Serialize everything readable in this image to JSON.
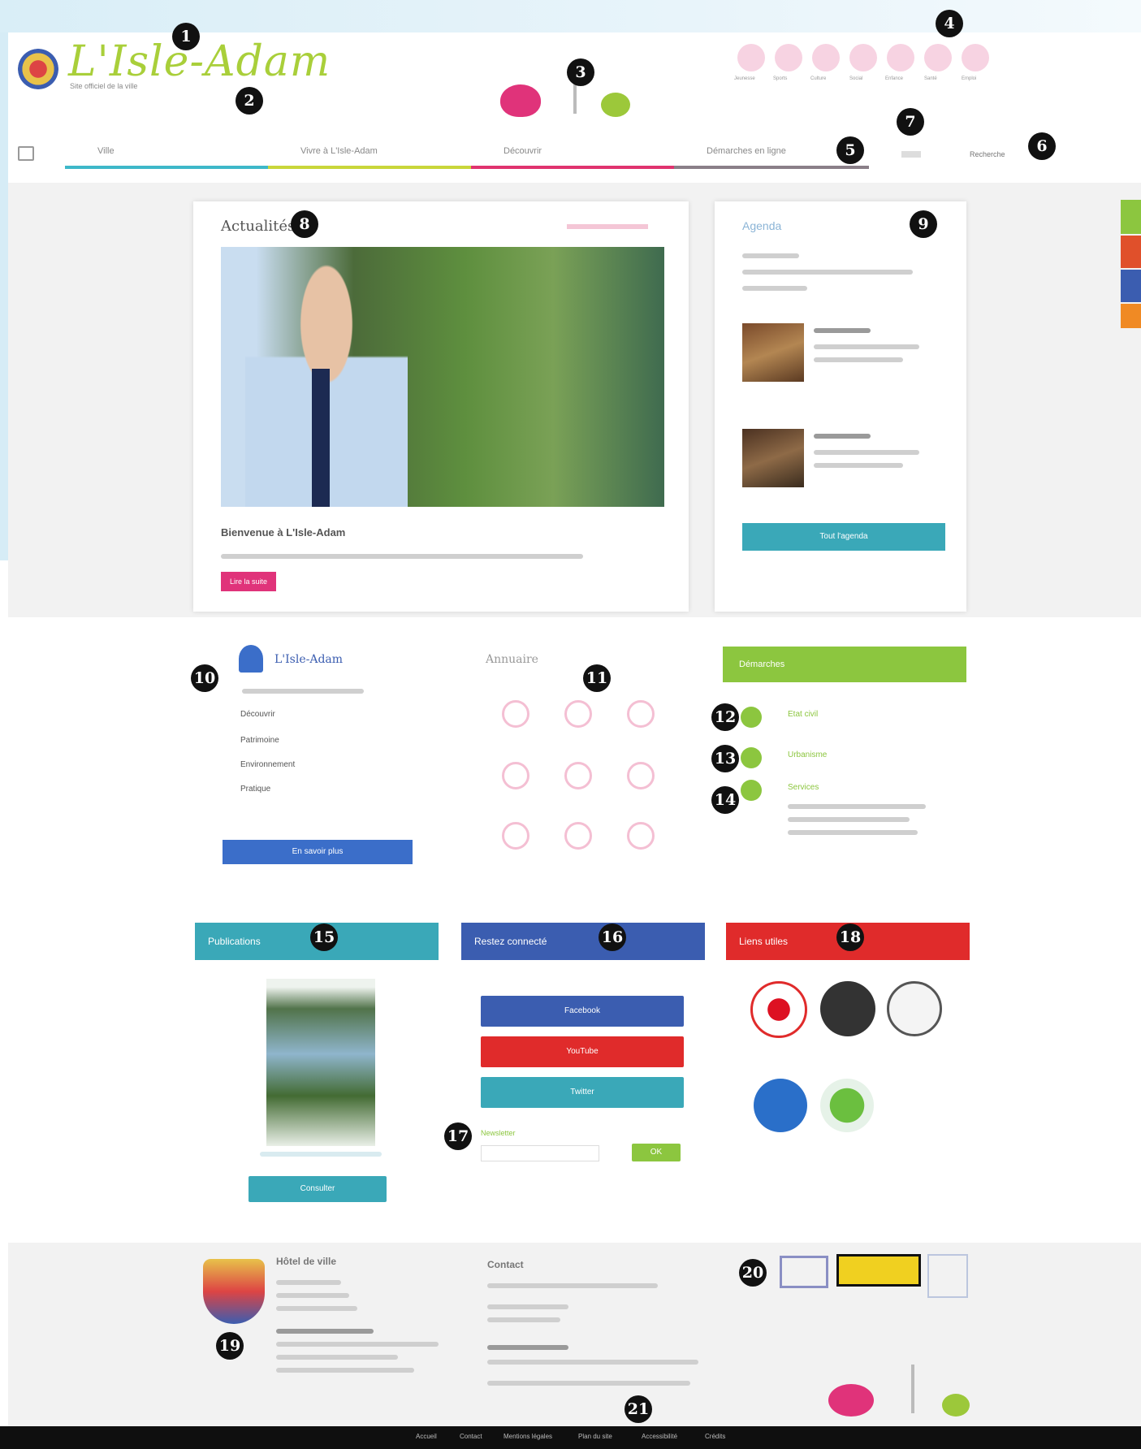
{
  "header": {
    "logo_text": "L'Isle-Adam",
    "tagline": "Site officiel de la ville",
    "quick_links": [
      "Jeunesse",
      "Sports",
      "Culture",
      "Social",
      "Enfance",
      "Santé",
      "Emploi"
    ]
  },
  "nav": {
    "items": [
      "Ville",
      "Vivre à L'Isle-Adam",
      "Découvrir",
      "Démarches en ligne"
    ],
    "search_placeholder": "Recherche",
    "accent_colors": [
      "#3eb8c9",
      "#c9d63a",
      "#e0336f",
      "#8a7f88"
    ]
  },
  "sections": {
    "actu": {
      "title": "Actualités",
      "caption": "Bienvenue à L'Isle-Adam",
      "more": "Lire la suite"
    },
    "agenda": {
      "title": "Agenda",
      "all_button": "Tout l'agenda"
    },
    "lisle_adam": {
      "title": "L'Isle-Adam",
      "links": [
        "Découvrir",
        "Patrimoine",
        "Environnement",
        "Pratique"
      ],
      "button": "En savoir plus"
    },
    "annuaire": {
      "title": "Annuaire"
    },
    "demarches": {
      "title": "Démarches",
      "items": [
        "Etat civil",
        "Urbanisme",
        "Services"
      ]
    },
    "publications": {
      "title": "Publications",
      "button": "Consulter"
    },
    "restez_connecte": {
      "title": "Restez connecté",
      "buttons": [
        "Facebook",
        "YouTube",
        "Twitter"
      ],
      "newsletter_label": "Newsletter",
      "newsletter_button": "OK"
    },
    "liens_utiles": {
      "title": "Liens utiles"
    }
  },
  "footer": {
    "col1_title": "Hôtel de ville",
    "col2_title": "Contact",
    "links": [
      "Accueil",
      "Contact",
      "Mentions légales",
      "Plan du site",
      "Accessibilité",
      "Crédits"
    ]
  },
  "callouts": [
    "1",
    "2",
    "3",
    "4",
    "5",
    "6",
    "7",
    "8",
    "9",
    "10",
    "11",
    "12",
    "13",
    "14",
    "15",
    "16",
    "17",
    "18",
    "19",
    "20",
    "21"
  ],
  "colors": {
    "green": "#8cc63f",
    "pink": "#e0337a",
    "teal": "#3aa8b8",
    "blue": "#3b5db0",
    "red": "#e02b2b",
    "dark": "#0f0f0f"
  }
}
